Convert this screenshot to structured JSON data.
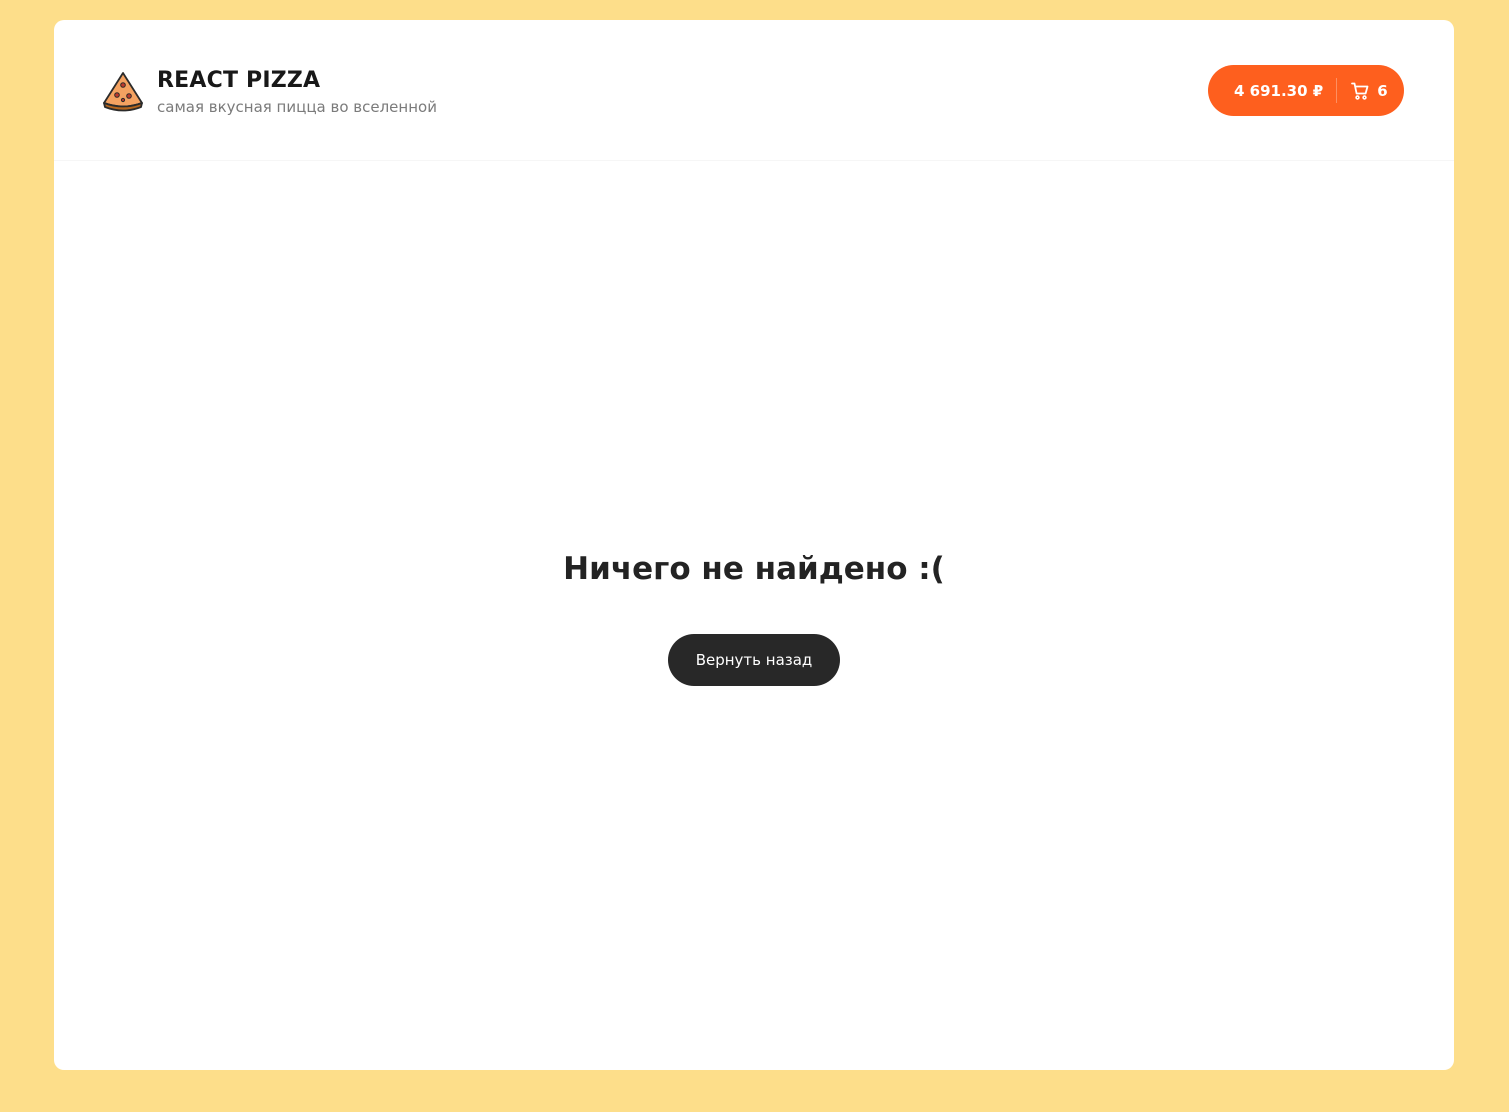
{
  "header": {
    "logo_title": "REACT PIZZA",
    "logo_subtitle": "самая вкусная пицца во вселенной",
    "logo_icon": "pizza-slice-icon"
  },
  "cart": {
    "total_price": "4 691.30 ₽",
    "item_count": "6",
    "icon": "shopping-cart-icon"
  },
  "main": {
    "empty_title": "Ничего не найдено :(",
    "back_button_label": "Вернуть назад"
  },
  "colors": {
    "page_background": "#FDDE8A",
    "accent": "#FE5F1E",
    "dark_button": "#282828",
    "card_background": "#FFFFFF"
  }
}
